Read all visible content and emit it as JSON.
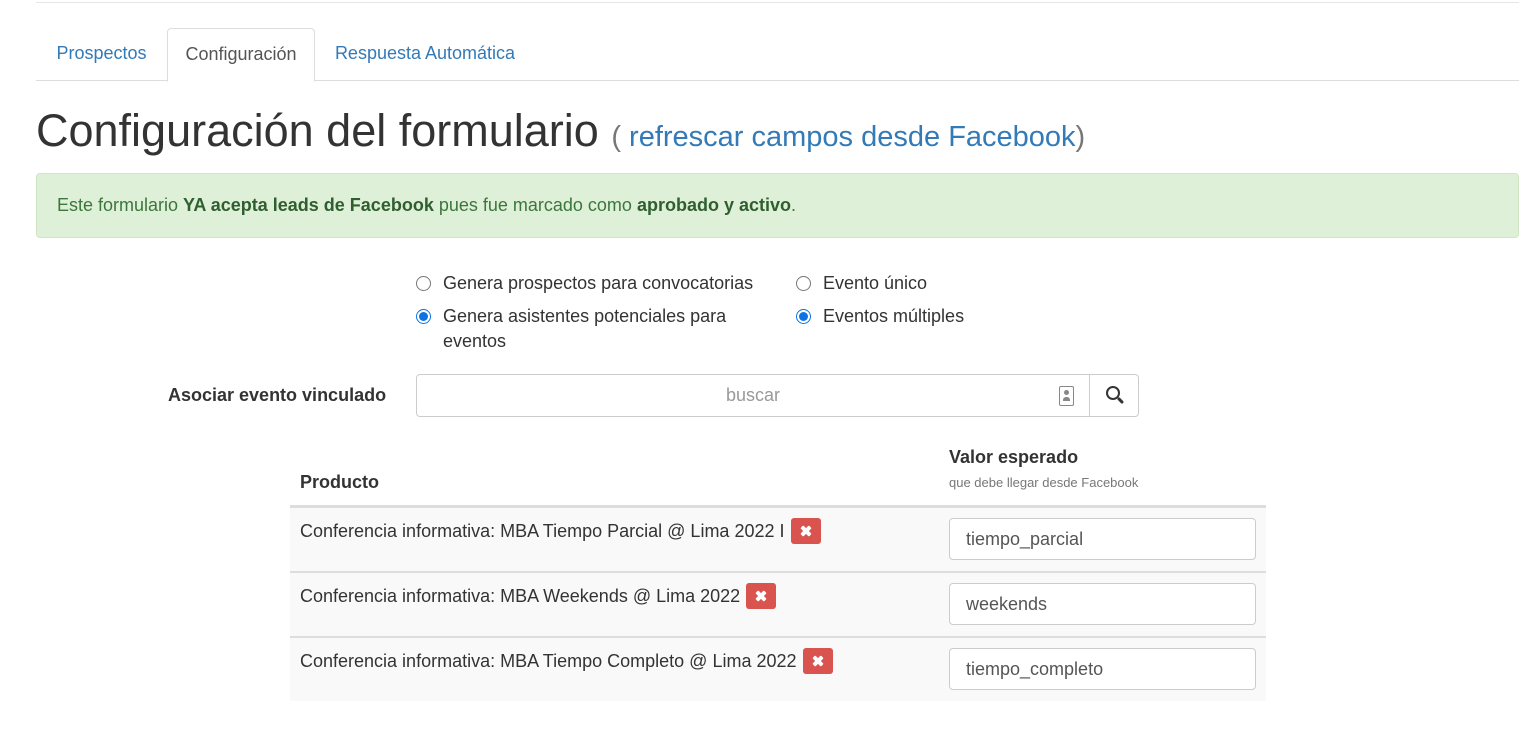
{
  "tabs": [
    {
      "label": "Prospectos"
    },
    {
      "label": "Configuración"
    },
    {
      "label": "Respuesta Automática"
    }
  ],
  "heading": {
    "title": "Configuración del formulario",
    "open_paren": "(",
    "refresh_link": "refrescar campos desde Facebook",
    "close_paren": ")"
  },
  "alert": {
    "text_1": "Este formulario ",
    "bold_1": "YA acepta leads de Facebook",
    "text_2": " pues fue marcado como ",
    "bold_2": "aprobado y activo",
    "text_3": "."
  },
  "options": {
    "generate_type": [
      {
        "label": "Genera prospectos para convocatorias",
        "checked": false
      },
      {
        "label": "Genera asistentes potenciales para eventos",
        "checked": true
      }
    ],
    "event_type": [
      {
        "label": "Evento único",
        "checked": false
      },
      {
        "label": "Eventos múltiples",
        "checked": true
      }
    ]
  },
  "search": {
    "label": "Asociar evento vinculado",
    "placeholder": "buscar",
    "value": ""
  },
  "table": {
    "col_product": "Producto",
    "col_value": "Valor esperado",
    "col_value_hint": "que debe llegar desde Facebook",
    "rows": [
      {
        "product": "Conferencia informativa: MBA Tiempo Parcial @ Lima 2022 I",
        "value": "tiempo_parcial"
      },
      {
        "product": "Conferencia informativa: MBA Weekends @ Lima 2022",
        "value": "weekends"
      },
      {
        "product": "Conferencia informativa: MBA Tiempo Completo @ Lima 2022",
        "value": "tiempo_completo"
      }
    ]
  },
  "colors": {
    "link": "#337ab7",
    "success_bg": "#dff0d8",
    "success_text": "#3c763d",
    "danger": "#d9534f",
    "radio_checked": "#0b73e3"
  }
}
